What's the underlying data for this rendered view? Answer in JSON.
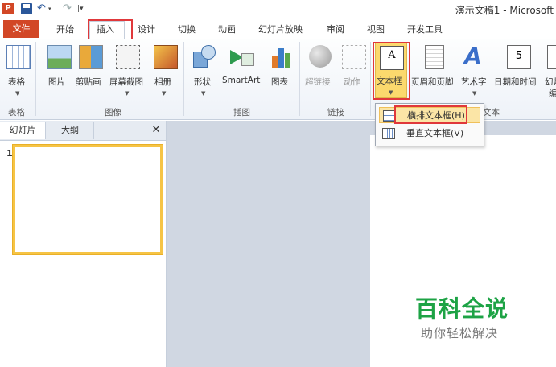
{
  "title": "演示文稿1 - Microsoft",
  "tabs": {
    "file": "文件",
    "home": "开始",
    "insert": "插入",
    "design": "设计",
    "transitions": "切换",
    "animations": "动画",
    "slideshow": "幻灯片放映",
    "review": "审阅",
    "view": "视图",
    "developer": "开发工具"
  },
  "ribbon": {
    "table": "表格",
    "picture": "图片",
    "clipart": "剪贴画",
    "screenshot": "屏幕截图",
    "album": "相册",
    "shapes": "形状",
    "smartart": "SmartArt",
    "chart": "图表",
    "hyperlink": "超链接",
    "action": "动作",
    "textbox": "文本框",
    "header_footer": "页眉和页脚",
    "wordart": "艺术字",
    "datetime": "日期和时间",
    "slide_number": "幻灯",
    "slide_number_2": "编",
    "groups": {
      "tables": "表格",
      "images": "图像",
      "illustrations": "插图",
      "links": "链接",
      "text": "文本"
    }
  },
  "textbox_menu": {
    "horizontal": "横排文本框(H)",
    "vertical": "垂直文本框(V)"
  },
  "left_pane": {
    "slides_tab": "幻灯片",
    "outline_tab": "大纲",
    "close": "✕",
    "slide_number": "1"
  },
  "watermark": {
    "title": "百科全说",
    "subtitle": "助你轻松解决"
  },
  "colors": {
    "file_tab": "#d24726",
    "highlight": "#e0383b",
    "selection": "#fbd96d",
    "watermark": "#1da345"
  }
}
